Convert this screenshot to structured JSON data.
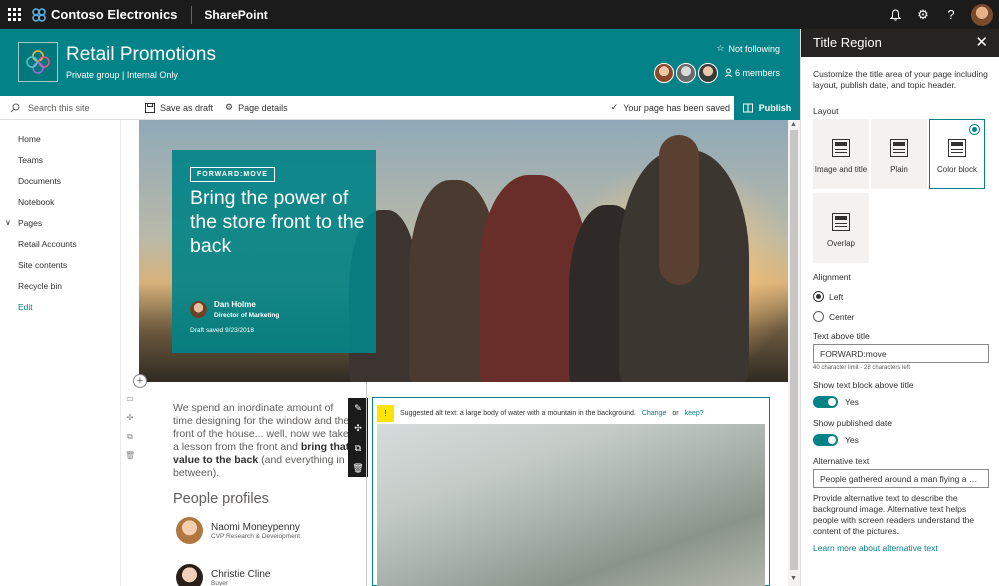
{
  "topbar": {
    "brand": "Contoso Electronics",
    "app": "SharePoint"
  },
  "site": {
    "title": "Retail Promotions",
    "subtitle": "Private group | Internal Only",
    "follow_label": "Not following",
    "members_label": "6 members"
  },
  "commandbar": {
    "search_placeholder": "Search this site",
    "save_draft": "Save as draft",
    "page_details": "Page details",
    "saved_status": "Your page has been saved",
    "publish": "Publish"
  },
  "nav": {
    "items": [
      "Home",
      "Teams",
      "Documents",
      "Notebook",
      "Pages",
      "Retail Accounts",
      "Site contents",
      "Recycle bin",
      "Edit"
    ]
  },
  "title_block": {
    "tag": "FORWARD:MOVE",
    "title": "Bring the power of the store front to the back",
    "author": "Dan Holme",
    "role": "Director of Marketing",
    "draft": "Draft saved 9/23/2018"
  },
  "body": {
    "paragraph_1": "We spend an inordinate amount of time designing for the window and the front of the house... well, now we take a lesson from the front and ",
    "paragraph_bold": "bring that value to the back",
    "paragraph_2": " (and everything in between)."
  },
  "profiles": {
    "title": "People profiles",
    "people": [
      {
        "name": "Naomi Moneypenny",
        "role": "CVP Research & Development"
      },
      {
        "name": "Christie Cline",
        "role": "Buyer"
      }
    ]
  },
  "image_alt": {
    "text": "Suggested alt text: a large body of water with a mountain in the background.",
    "change": "Change",
    "or": "or",
    "keep": "keep?"
  },
  "panel": {
    "title": "Title Region",
    "description": "Customize the title area of your page including layout, publish date, and topic header.",
    "layout_label": "Layout",
    "layouts": [
      "Image and title",
      "Plain",
      "Color block",
      "Overlap"
    ],
    "selected_layout": "Color block",
    "alignment_label": "Alignment",
    "alignments": [
      "Left",
      "Center"
    ],
    "selected_alignment": "Left",
    "text_above_label": "Text above title",
    "text_above_value": "FORWARD:move",
    "text_above_help": "40 character limit - 28 characters left",
    "show_block_label": "Show text block above title",
    "show_block_value": "Yes",
    "show_date_label": "Show published date",
    "show_date_value": "Yes",
    "alt_label": "Alternative text",
    "alt_value": "People gathered around a man flying a dr...",
    "alt_help": "Provide alternative text to describe the background image. Alternative text helps people with screen readers understand the content of the pictures.",
    "learn_more": "Learn more about alternative text"
  },
  "colors": {
    "accent": "#038387",
    "topbar": "#1b1b1b",
    "panel_header": "#252423"
  },
  "icons": [
    "waffle-icon",
    "contoso-logo-icon",
    "bell-icon",
    "gear-icon",
    "help-icon",
    "star-icon",
    "person-icon",
    "search-icon",
    "save-icon",
    "gear-icon",
    "check-icon",
    "book-icon",
    "chevron-down-icon",
    "plus-icon",
    "pencil-icon",
    "move-icon",
    "copy-icon",
    "delete-icon",
    "warning-icon",
    "close-icon"
  ]
}
